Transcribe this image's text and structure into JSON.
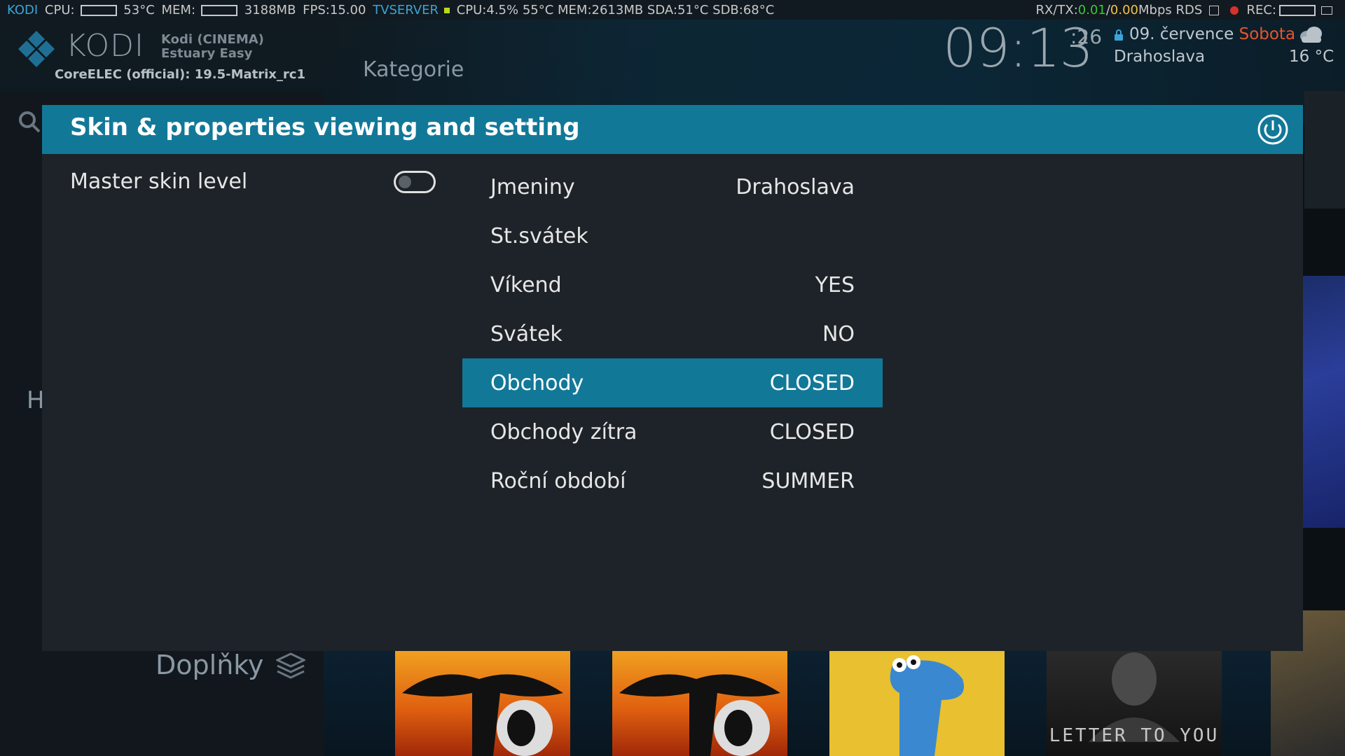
{
  "statusbar": {
    "app": "KODI",
    "cpu_label": "CPU:",
    "cpu_temp": "53°C",
    "mem_label": "MEM:",
    "mem_value": "3188MB",
    "fps": "FPS:15.00",
    "server": "TVSERVER",
    "server_stats": "CPU:4.5% 55°C MEM:2613MB SDA:51°C SDB:68°C",
    "rxtx_label": "RX/TX:",
    "rx": "0.01",
    "tx_sep": "/",
    "tx": "0.00",
    "rx_unit": "Mbps RDS",
    "rec_label": "REC:"
  },
  "header": {
    "logo_word": "KODI",
    "profile_line1": "Kodi (CINEMA)",
    "profile_line2": "Estuary Easy",
    "build": "CoreELEC (official): 19.5-Matrix_rc1",
    "category": "Kategorie"
  },
  "clock": {
    "time": "09:13",
    "seconds": ":26",
    "date": "09. července",
    "day": "Sobota",
    "nameday": "Drahoslava",
    "temperature": "16 °C",
    "weather_icon": "cloud-icon"
  },
  "side": {
    "h_letter": "H"
  },
  "bottom": {
    "doplnky": "Doplňky",
    "tile_text": "LETTER TO YOU"
  },
  "dialog": {
    "title": "Skin & properties viewing and setting",
    "master_label": "Master skin level",
    "master_toggle": false,
    "properties": [
      {
        "label": "Jmeniny",
        "value": "Drahoslava"
      },
      {
        "label": "St.svátek",
        "value": ""
      },
      {
        "label": "Víkend",
        "value": "YES"
      },
      {
        "label": "Svátek",
        "value": "NO"
      },
      {
        "label": "Obchody",
        "value": "CLOSED",
        "focused": true
      },
      {
        "label": "Obchody zítra",
        "value": "CLOSED"
      },
      {
        "label": "Roční období",
        "value": "SUMMER"
      }
    ]
  },
  "colors": {
    "accent": "#127898",
    "dialog_bg": "#1d2328",
    "status_blue": "#3aa4d8",
    "status_green": "#37c837",
    "status_orange": "#f5c04a",
    "day_red": "#e8542a"
  }
}
